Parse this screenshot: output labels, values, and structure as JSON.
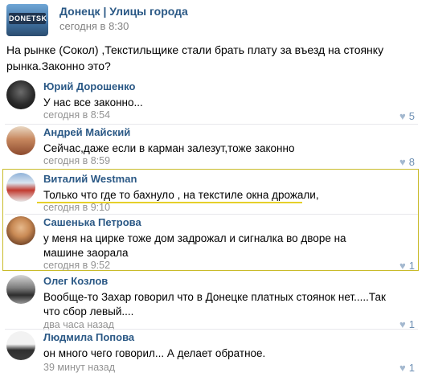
{
  "post": {
    "group_name": "Донецк | Улицы города",
    "time": "сегодня в 8:30",
    "logo": "DONETSK",
    "text": "На рынке (Сокол) ,Текстильщике стали брать плату за въезд на стоянку рынка.Законно это?"
  },
  "comments": [
    {
      "author": "Юрий Дорошенко",
      "text": "У нас все законно...",
      "time": "сегодня в 8:54",
      "likes": "5"
    },
    {
      "author": "Андрей Майский",
      "text": "Сейчас,даже если в карман залезут,тоже законно",
      "time": "сегодня в 8:59",
      "likes": "8"
    },
    {
      "author": "Виталий Westman",
      "text": "Только что где то бахнуло , на текстиле окна дрожали,",
      "time": "сегодня в 9:10",
      "likes": ""
    },
    {
      "author": "Сашенька Петрова",
      "text": "у меня на цирке тоже дом задрожал и сигналка во дворе на машине заорала",
      "time": "сегодня в 9:52",
      "likes": "1"
    },
    {
      "author": "Олег Козлов",
      "text": "Вообще-то Захар говорил что в Донецке платных стоянок нет.....Так что сбор левый....",
      "time": "два часа назад",
      "likes": "1"
    },
    {
      "author": "Людмила Попова",
      "text": "он много чего говорил... А делает обратное.",
      "time": "39 минут назад",
      "likes": "1"
    }
  ],
  "colors": {
    "link": "#2a5885",
    "meta": "#939393",
    "highlight_border": "#c9bb2a",
    "underline": "#e6d02a"
  },
  "icons": {
    "like": "heart-icon"
  }
}
